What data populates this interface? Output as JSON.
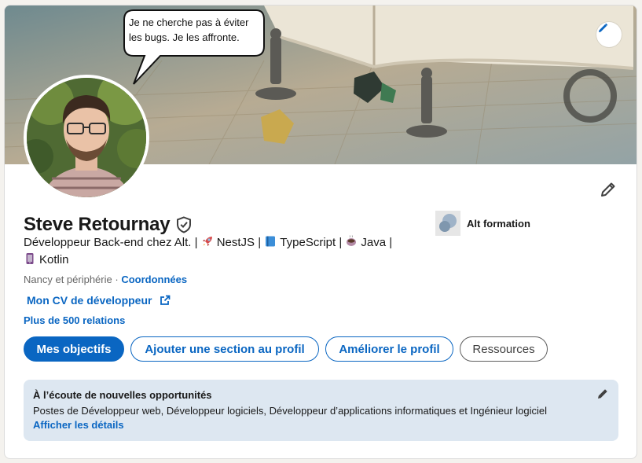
{
  "profile": {
    "banner_quote": "Je ne cherche pas à éviter les bugs. Je les affronte.",
    "name": "Steve Retournay",
    "headline": {
      "prefix": "Développeur Back-end chez Alt. |",
      "tech1": "NestJS |",
      "tech2": "TypeScript |",
      "tech3": "Java |",
      "tech4": "Kotlin"
    },
    "location": "Nancy et périphérie",
    "separator": "·",
    "contact_link": "Coordonnées",
    "cv_link": "Mon CV de développeur",
    "relations": "Plus de 500 relations",
    "company": "Alt formation"
  },
  "actions": {
    "goals": "Mes objectifs",
    "add_section": "Ajouter une section au profil",
    "improve": "Améliorer le profil",
    "resources": "Ressources"
  },
  "open_to_work": {
    "title": "À l’écoute de nouvelles opportunités",
    "description": "Postes de Développeur web, Développeur logiciels, Développeur d’applications informatiques et Ingénieur logiciel",
    "details_link": "Afficher les détails"
  },
  "icons": {
    "banner_edit": "pencil-icon",
    "intro_edit": "pencil-icon",
    "verified": "shield-check-icon",
    "external_link": "external-link-icon",
    "rocket": "rocket-emoji",
    "book": "blue-book-emoji",
    "coffee": "coffee-emoji",
    "phone": "mobile-phone-emoji"
  },
  "colors": {
    "accent": "#0a66c2",
    "open_to_work_bg": "#dde7f1",
    "text": "#191919",
    "muted": "#666666"
  }
}
